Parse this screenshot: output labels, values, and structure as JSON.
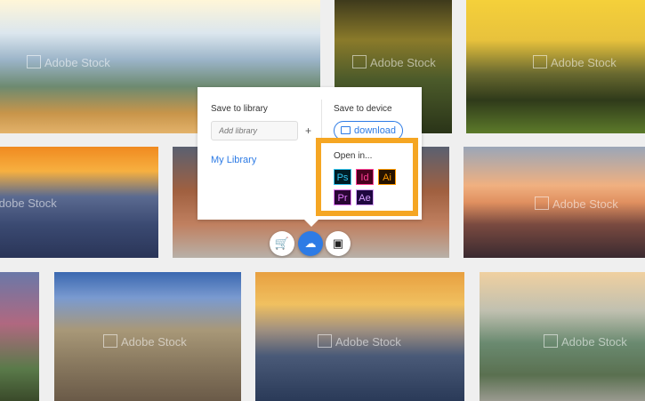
{
  "watermark": "Adobe Stock",
  "popup": {
    "save_library_label": "Save to library",
    "add_library_placeholder": "Add library",
    "plus": "+",
    "my_library": "My Library",
    "save_device_label": "Save to device",
    "download_label": "download",
    "open_in_label": "Open in...",
    "apps": [
      "Ps",
      "Id",
      "Ai",
      "Pr",
      "Ae"
    ]
  },
  "actions": [
    "add-to-cart",
    "save-to-cloud",
    "compare"
  ],
  "colors": {
    "accent": "#2d7be5",
    "highlight": "#f5a623"
  }
}
